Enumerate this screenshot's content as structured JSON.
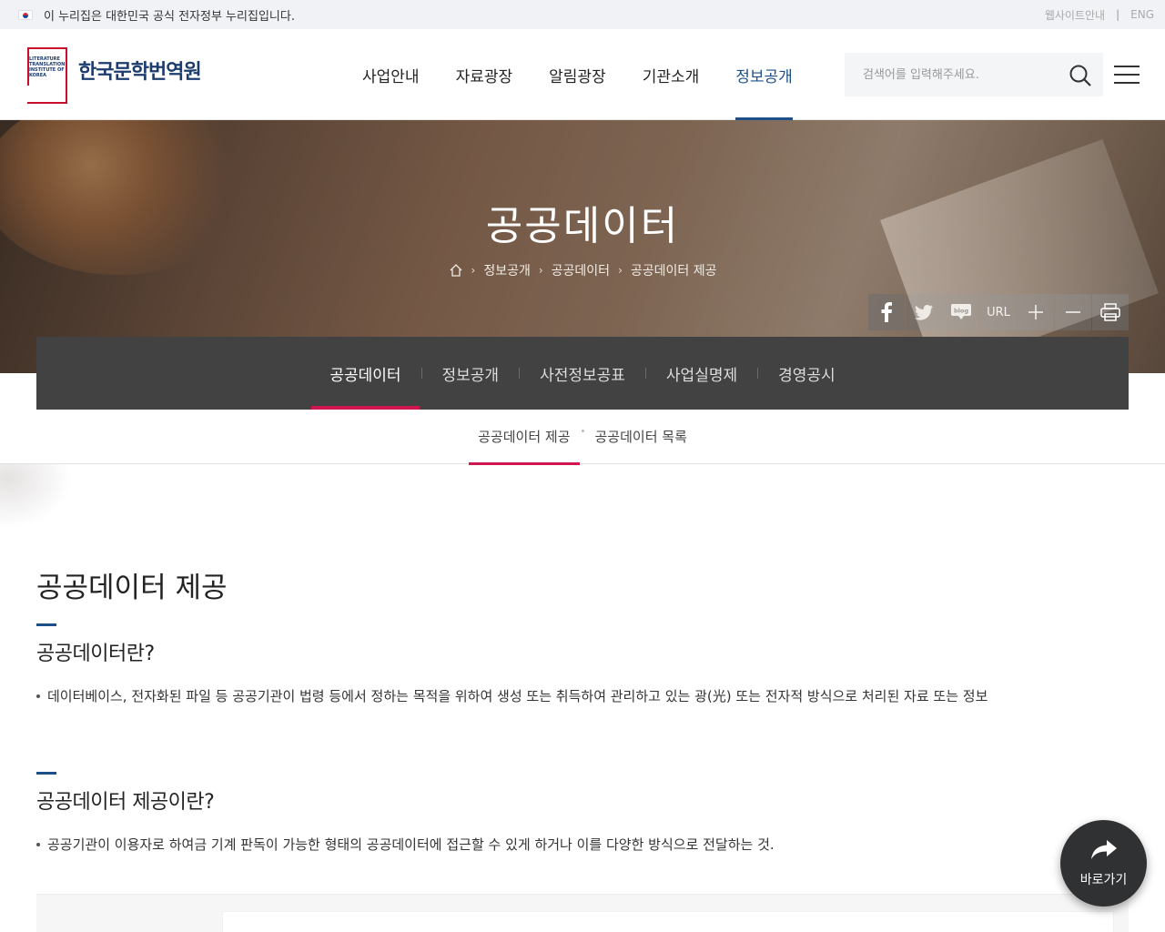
{
  "gov_bar": {
    "notice": "이 누리집은 대한민국 공식 전자정부 누리집입니다.",
    "util_links": [
      "웹사이트안내",
      "ENG"
    ]
  },
  "header": {
    "logo_small_text": [
      "LITERATURE",
      "TRANSLATION",
      "INSTITUTE OF",
      "KOREA"
    ],
    "logo_name": "한국문학번역원",
    "gnb": [
      "사업안내",
      "자료광장",
      "알림광장",
      "기관소개",
      "정보공개"
    ],
    "gnb_active": "정보공개",
    "search_placeholder": "검색어를 입력해주세요."
  },
  "visual": {
    "title": "공공데이터",
    "breadcrumb": [
      "정보공개",
      "공공데이터",
      "공공데이터 제공"
    ],
    "share_url_label": "URL"
  },
  "lnb": {
    "items": [
      "공공데이터",
      "정보공개",
      "사전정보공표",
      "사업실명제",
      "경영공시"
    ],
    "active": "공공데이터"
  },
  "tabs": {
    "items": [
      "공공데이터 제공",
      "공공데이터 목록"
    ],
    "active": "공공데이터 제공"
  },
  "content": {
    "page_title": "공공데이터 제공",
    "sections": [
      {
        "heading": "공공데이터란?",
        "text": "데이터베이스, 전자화된 파일 등 공공기관이 법령 등에서 정하는 목적을 위하여 생성 또는 취득하여 관리하고 있는 광(光) 또는 전자적 방식으로 처리된 자료 또는 정보"
      },
      {
        "heading": "공공데이터 제공이란?",
        "text": "공공기관이 이용자로 하여금 기계 판독이 가능한 형태의 공공데이터에 접근할 수 있게 하거나 이를 다양한 방식으로 전달하는 것."
      }
    ]
  },
  "quick": {
    "label": "바로가기"
  },
  "colors": {
    "primary_blue": "#1d4f8a",
    "accent_pink": "#d0164f",
    "lnb_bg": "#424242",
    "logo_red": "#c8102e"
  }
}
